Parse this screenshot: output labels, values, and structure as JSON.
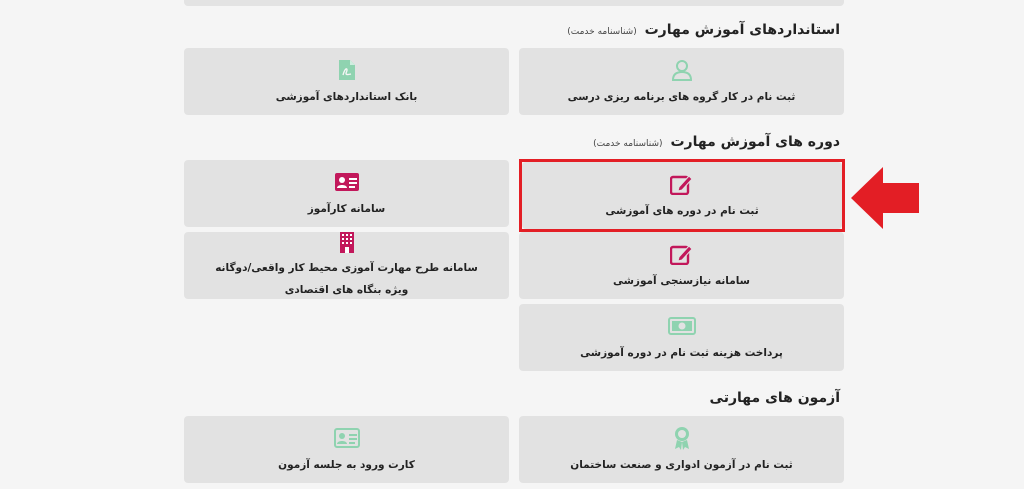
{
  "sections": {
    "standards": {
      "title": "استانداردهای آموزش مهارت",
      "subtitle": "(شناسنامه خدمت)"
    },
    "courses": {
      "title": "دوره های آموزش مهارت",
      "subtitle": "(شناسنامه خدمت)"
    },
    "exams": {
      "title": "آزمون های مهارتی"
    }
  },
  "cards": {
    "register_workgroup": {
      "label": "ثبت نام در کار گروه های برنامه ریزی درسی",
      "icon": "user-icon"
    },
    "standards_bank": {
      "label": "بانک استانداردهای آموزشی",
      "icon": "pdf-file-icon"
    },
    "register_courses": {
      "label": "ثبت نام در دوره های آموزشی",
      "icon": "edit-icon"
    },
    "karamooz": {
      "label": "سامانه کارآموز",
      "icon": "id-card-icon"
    },
    "needs_assessment": {
      "label": "سامانه نیازسنجی آموزشی",
      "icon": "edit-icon"
    },
    "workplace_training": {
      "label_line1": "سامانه طرح مهارت آموزی محیط کار واقعی/دوگانه",
      "label_line2": "ویژه بنگاه های اقتصادی",
      "icon": "building-icon"
    },
    "payment": {
      "label": "پرداخت هزینه ثبت نام در دوره آموزشی",
      "icon": "money-icon"
    },
    "register_exam": {
      "label": "ثبت نام در آزمون ادواری و صنعت ساختمان",
      "icon": "badge-icon"
    },
    "exam_card": {
      "label": "کارت ورود به جلسه آزمون",
      "icon": "id-card-icon"
    }
  },
  "colors": {
    "accent_red": "#e31e25",
    "icon_green": "#8fd3b0",
    "icon_crimson": "#c2185b",
    "card_bg": "#e2e2e2",
    "page_bg": "#f5f5f5"
  }
}
